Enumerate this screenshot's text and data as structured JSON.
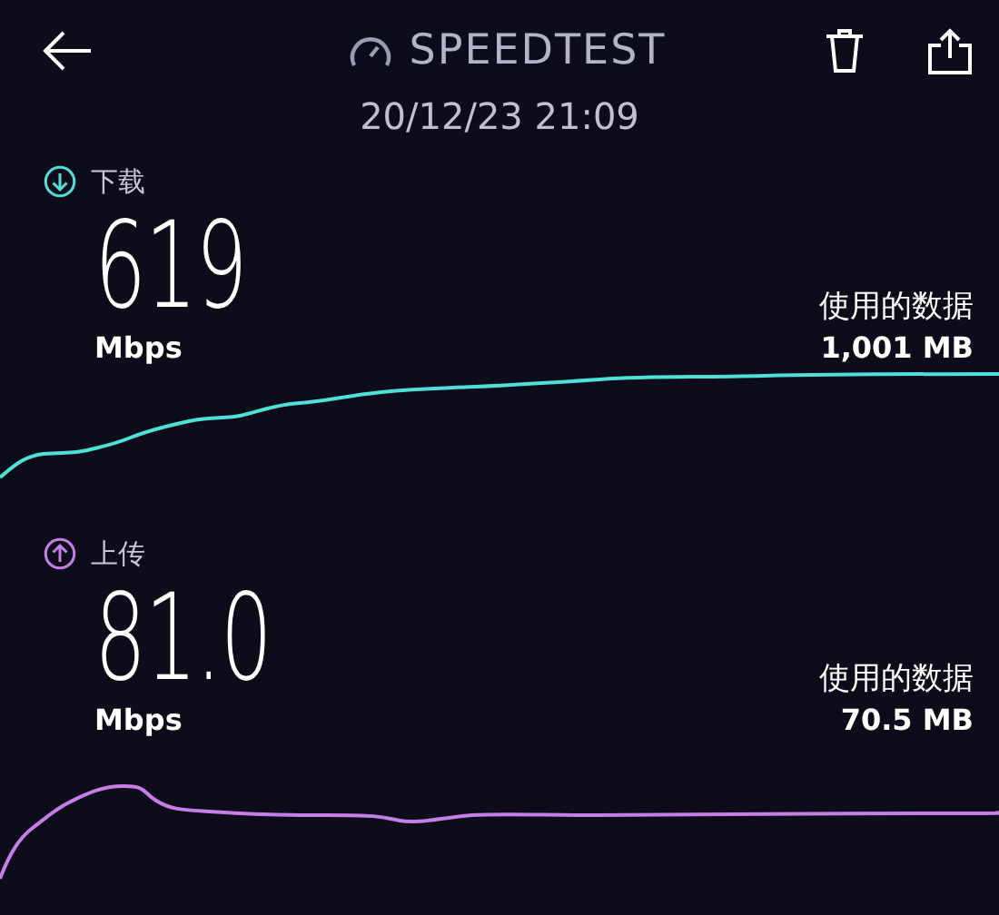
{
  "header": {
    "title": "SPEEDTEST",
    "date": "20/12/23 21:09"
  },
  "sections": [
    {
      "kind": "download",
      "label": "下载",
      "value": "619",
      "unit": "Mbps",
      "data_label": "使用的数据",
      "data_value": "1,001 MB"
    },
    {
      "kind": "upload",
      "label": "上传",
      "value": "81.0",
      "unit": "Mbps",
      "data_label": "使用的数据",
      "data_value": "70.5 MB"
    }
  ]
}
